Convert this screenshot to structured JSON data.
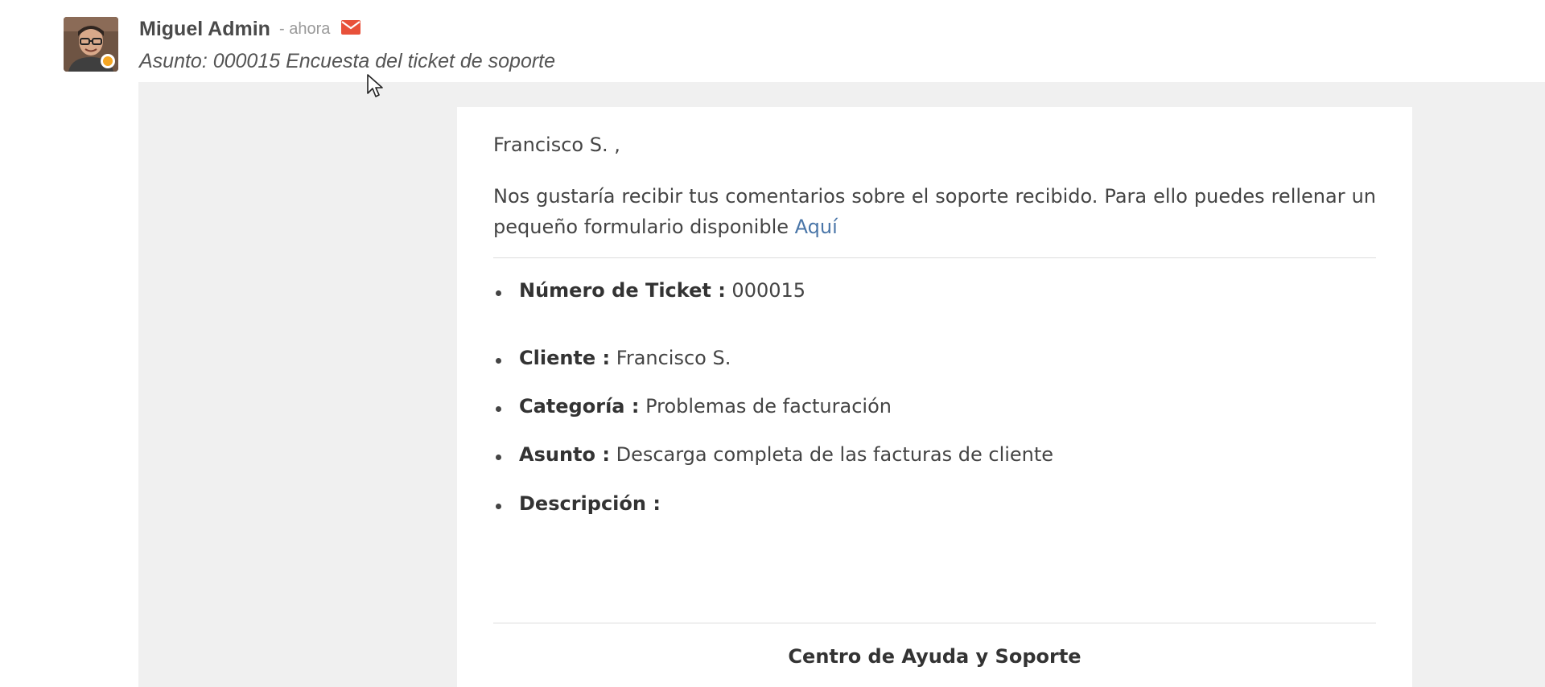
{
  "message": {
    "author": "Miguel Admin",
    "time": "- ahora",
    "subject": "Asunto: 000015 Encuesta del ticket de soporte",
    "presence_status_color": "#f5a623",
    "mail_icon": "envelope-icon",
    "mail_icon_color": "#e8513a"
  },
  "email": {
    "greeting": "Francisco S. ,",
    "intro_text": "Nos gustaría recibir tus comentarios sobre el soporte recibido. Para ello puedes rellenar un pequeño formulario disponible ",
    "intro_link": "Aquí",
    "details": [
      {
        "label": "Número de Ticket :",
        "value": " 000015"
      },
      {
        "label": "Cliente :",
        "value": " Francisco S."
      },
      {
        "label": "Categoría :",
        "value": " Problemas de facturación"
      },
      {
        "label": "Asunto :",
        "value": " Descarga completa de las facturas de cliente"
      },
      {
        "label": "Descripción :",
        "value": ""
      }
    ],
    "footer_title": "Centro de Ayuda y Soporte"
  },
  "colors": {
    "link": "#4a76a8",
    "mail_background": "#f0f0f0"
  }
}
